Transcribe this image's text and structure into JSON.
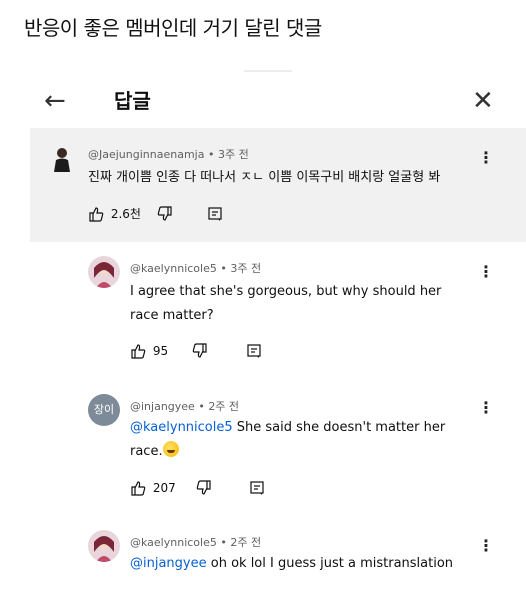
{
  "caption": "반응이 좋은 멤버인데 거기 달린 댓글",
  "panel": {
    "title": "답글",
    "back_icon": "arrow-left-icon",
    "close_icon": "close-icon"
  },
  "main_comment": {
    "author": "@Jaejunginnaenamja",
    "time": "3주 전",
    "text": "진짜 개이쁨 인종 다 떠나서 ㅈㄴ 이쁨 이목구비 배치랑 얼굴형 봐",
    "likes": "2.6천"
  },
  "replies": [
    {
      "author": "@kaelynnicole5",
      "time": "3주 전",
      "text_line1": "I agree that she's gorgeous, but why should her",
      "text_line2": "race matter?",
      "likes": "95"
    },
    {
      "author": "@injangyee",
      "avatar_text": "장이",
      "time": "2주 전",
      "mention": "@kaelynnicole5",
      "text_line1": " She said she doesn't matter her",
      "text_line2": "race.",
      "likes": "207"
    },
    {
      "author": "@kaelynnicole5",
      "time": "2주 전",
      "mention": "@injangyee",
      "text_line1": " oh ok lol I guess just a mistranslation"
    }
  ],
  "colors": {
    "highlight_bg": "#f1f1f1",
    "mention": "#065fd4",
    "meta_text": "#606060"
  }
}
